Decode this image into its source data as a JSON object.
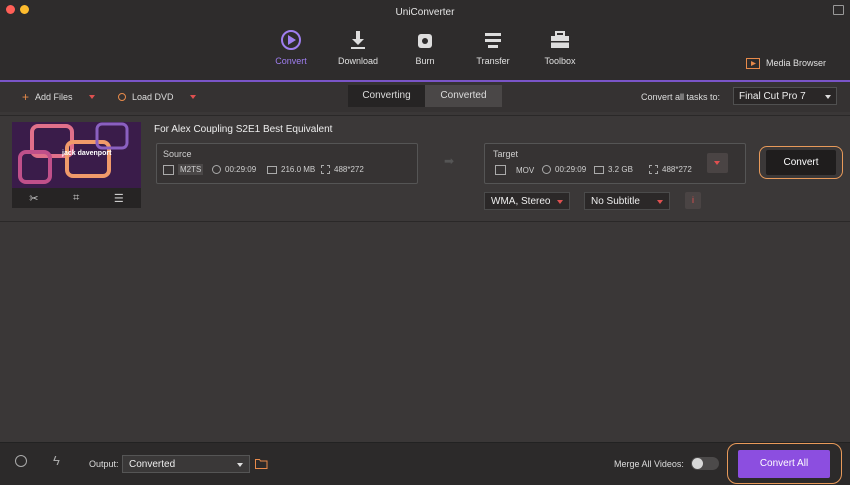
{
  "window": {
    "title": "UniConverter"
  },
  "colors": {
    "accent": "#8c4ee0",
    "highlight": "#e89a5a",
    "red": "#e05050"
  },
  "nav": {
    "items": [
      {
        "label": "Convert",
        "icon": "convert-icon"
      },
      {
        "label": "Download",
        "icon": "download-icon"
      },
      {
        "label": "Burn",
        "icon": "burn-icon"
      },
      {
        "label": "Transfer",
        "icon": "transfer-icon"
      },
      {
        "label": "Toolbox",
        "icon": "toolbox-icon"
      }
    ],
    "active": "Convert",
    "media_browser": "Media Browser"
  },
  "toolbar": {
    "add_files": "Add Files",
    "load_dvd": "Load DVD",
    "tabs": [
      "Converting",
      "Converted"
    ],
    "active_tab": "Converting",
    "convert_all_label": "Convert all tasks to:",
    "convert_all_value": "Final Cut Pro 7"
  },
  "item": {
    "title": "For Alex Coupling S2E1 Best Equivalent",
    "thumbnail_text": "jack davenport",
    "source": {
      "label": "Source",
      "format": "M2TS",
      "duration": "00:29:09",
      "size": "216.0 MB",
      "resolution": "488*272"
    },
    "target": {
      "label": "Target",
      "format": "MOV",
      "duration": "00:29:09",
      "size": "3.2 GB",
      "resolution": "488*272"
    },
    "audio": "WMA, Stereo",
    "subtitle": "No Subtitle",
    "info": "i",
    "convert_button": "Convert"
  },
  "bottom": {
    "output_label": "Output:",
    "output_value": "Converted",
    "merge_label": "Merge All Videos:",
    "merge_on": false,
    "convert_all": "Convert All"
  }
}
